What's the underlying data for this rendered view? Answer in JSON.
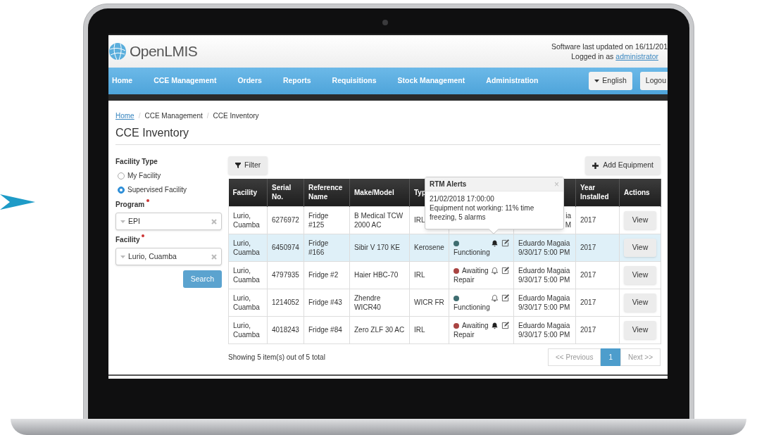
{
  "header": {
    "logo": "OpenLMIS",
    "updated": "Software last updated on 16/11/201",
    "logged_in": "Logged in as",
    "user": "administrator"
  },
  "nav": {
    "items": [
      {
        "label": "Home"
      },
      {
        "label": "CCE Management"
      },
      {
        "label": "Orders"
      },
      {
        "label": "Reports"
      },
      {
        "label": "Requisitions"
      },
      {
        "label": "Stock Management"
      },
      {
        "label": "Administration"
      }
    ],
    "language": "English",
    "logout": "Logou"
  },
  "breadcrumb": [
    "Home",
    "CCE Management",
    "CCE Inventory"
  ],
  "breadcrumb_separator": "/",
  "title": "CCE Inventory",
  "filters": {
    "facility_type_label": "Facility Type",
    "options": [
      {
        "label": "My Facility",
        "selected": false
      },
      {
        "label": "Supervised Facility",
        "selected": true
      }
    ],
    "program_label": "Program",
    "program": "EPI",
    "facility_label": "Facility",
    "facility": "Lurio, Cuamba",
    "search": "Search"
  },
  "toolbar": {
    "filter": "Filter",
    "add": "Add Equipment"
  },
  "table": {
    "columns": [
      "Facility",
      "Serial No.",
      "Reference Name",
      "Make/Model",
      "Typ",
      "Year Installed",
      "Actions"
    ],
    "rows": [
      {
        "facility": "Lurio, Cuamba",
        "serial": "6276972",
        "reference": "Fridge #125",
        "model": "B Medical TCW 2000 AC",
        "type": "IRL",
        "updated": [
          "ia",
          "M"
        ],
        "covered": true,
        "year": "2017",
        "action": "View",
        "selected": false
      },
      {
        "facility": "Lurio, Cuamba",
        "serial": "6450974",
        "reference": "Fridge #166",
        "model": "Sibir V 170 KE",
        "type": "Kerosene",
        "status": "Functioning",
        "color": "#3e6d70",
        "alert": true,
        "updated": [
          "Eduardo Magaia",
          "9/30/17 5:00 PM"
        ],
        "covered": false,
        "year": "2017",
        "action": "View",
        "selected": true
      },
      {
        "facility": "Lurio, Cuamba",
        "serial": "4797935",
        "reference": "Fridge #2",
        "model": "Haier HBC-70",
        "type": "IRL",
        "status": "Awaiting Repair",
        "color": "#a94442",
        "alert": false,
        "updated": [
          "Eduardo Magaia",
          "9/30/17 5:00 PM"
        ],
        "covered": false,
        "year": "2017",
        "action": "View",
        "selected": false
      },
      {
        "facility": "Lurio, Cuamba",
        "serial": "1214052",
        "reference": "Fridge #43",
        "model": "Zhendre WICR40",
        "type": "WICR FR",
        "status": "Functioning",
        "color": "#3e6d70",
        "alert": false,
        "updated": [
          "Eduardo Magaia",
          "9/30/17 5:00 PM"
        ],
        "covered": false,
        "year": "2017",
        "action": "View",
        "selected": false
      },
      {
        "facility": "Lurio, Cuamba",
        "serial": "4018243",
        "reference": "Fridge #84",
        "model": "Zero ZLF 30 AC",
        "type": "IRL",
        "status": "Awaiting Repair",
        "color": "#a94442",
        "alert": true,
        "updated": [
          "Eduardo Magaia",
          "9/30/17 5:00 PM"
        ],
        "covered": false,
        "year": "2017",
        "action": "View",
        "selected": false
      }
    ]
  },
  "popover": {
    "title": "RTM Alerts",
    "close": "×",
    "time": "21/02/2018 17:00:00",
    "message": "Equipment not working: 11% time freezing, 5 alarms"
  },
  "footer": {
    "showing": "Showing 5 item(s) out of 5 total",
    "pages": [
      {
        "label": "<< Previous",
        "selected": false
      },
      {
        "label": "1",
        "selected": true
      },
      {
        "label": "Next >>",
        "selected": false
      }
    ]
  }
}
